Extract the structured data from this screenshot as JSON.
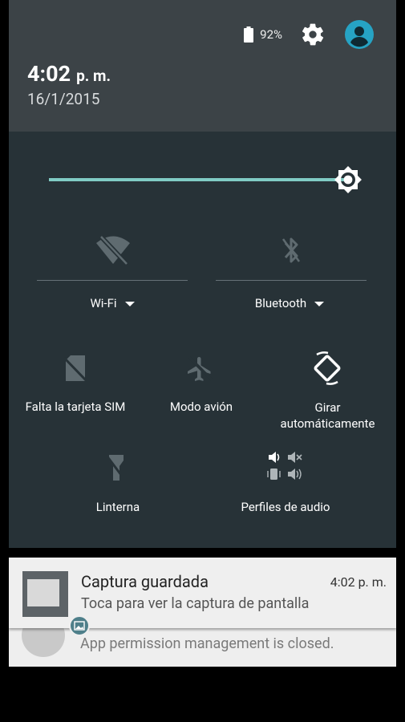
{
  "status": {
    "battery": "92%"
  },
  "clock": {
    "time": "4:02",
    "ampm": "p. m.",
    "date": "16/1/2015"
  },
  "quick_settings": {
    "wifi_label": "Wi-Fi",
    "bluetooth_label": "Bluetooth",
    "sim_label": "Falta la tarjeta SIM",
    "airplane_label": "Modo avión",
    "rotate_label_line1": "Girar",
    "rotate_label_line2": "automáticamente",
    "flashlight_label": "Linterna",
    "audio_label": "Perfiles de audio",
    "brightness": 0.96
  },
  "notifications": [
    {
      "title": "Captura guardada",
      "time": "4:02 p. m.",
      "text": "Toca para ver la captura de pantalla"
    },
    {
      "text": "App permission management is closed."
    }
  ],
  "colors": {
    "header_bg": "#3c4347",
    "panel_bg": "#273237",
    "accent": "#80cbc4",
    "avatar": "#26a3c4"
  }
}
